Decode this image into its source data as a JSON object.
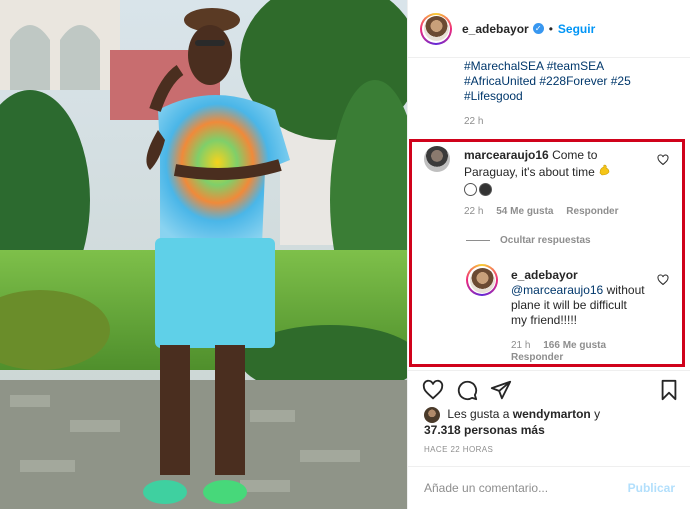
{
  "post": {
    "author": "e_adebayor",
    "follow_label": "Seguir",
    "separator": "•",
    "caption_lines": [
      "#MarechalSEA #teamSEA",
      "#AfricaUnited #228Forever #25",
      "#Lifesgood"
    ],
    "caption_time": "22 h"
  },
  "comments": [
    {
      "username": "marcearaujo16",
      "text_line1": "Come to",
      "text_line2": "Paraguay, it's about time",
      "time": "22 h",
      "likes": "54 Me gusta",
      "reply_label": "Responder",
      "icons": [
        "flexed-biceps-emoji",
        "white-circle-emoji",
        "black-circle-emoji"
      ]
    }
  ],
  "hide_replies_label": "Ocultar respuestas",
  "reply": {
    "username": "e_adebayor",
    "mention": "@marcearaujo16",
    "text_line1": "without",
    "text_line2": "plane it will be difficult",
    "text_line3": "my friend!!!!!",
    "time": "21 h",
    "likes": "166 Me gusta",
    "reply_label": "Responder"
  },
  "likes_summary": {
    "prefix": "Les gusta a",
    "user": "wendymarton",
    "suffix": "y",
    "count": "37.318 personas más"
  },
  "timestamp": "HACE 22 HORAS",
  "comment_box": {
    "placeholder": "Añade un comentario...",
    "publish_label": "Publicar"
  },
  "colors": {
    "accent": "#0095f6",
    "highlight_border": "#d0021b",
    "hashtag": "#00376b",
    "muted": "#8e8e8e"
  }
}
